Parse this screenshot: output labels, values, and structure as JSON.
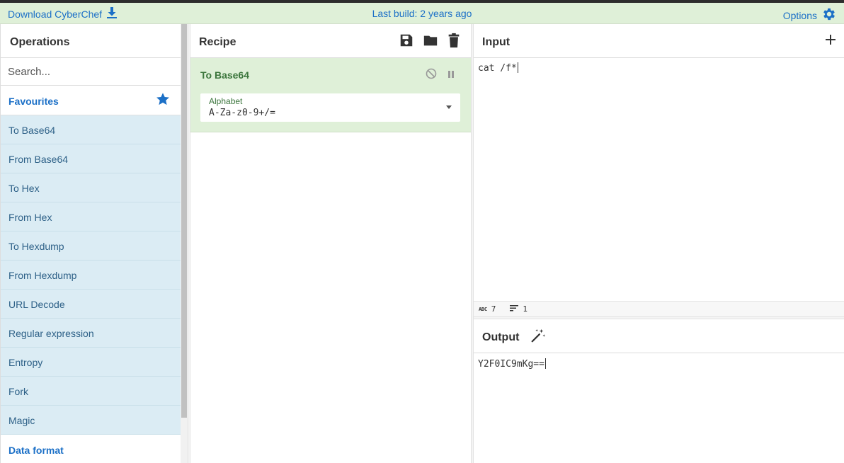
{
  "banner": {
    "download_label": "Download CyberChef",
    "last_build": "Last build: 2 years ago",
    "options_label": "Options"
  },
  "operations": {
    "title": "Operations",
    "search_placeholder": "Search...",
    "favourites_label": "Favourites",
    "items": [
      {
        "label": "To Base64"
      },
      {
        "label": "From Base64"
      },
      {
        "label": "To Hex"
      },
      {
        "label": "From Hex"
      },
      {
        "label": "To Hexdump"
      },
      {
        "label": "From Hexdump"
      },
      {
        "label": "URL Decode"
      },
      {
        "label": "Regular expression"
      },
      {
        "label": "Entropy"
      },
      {
        "label": "Fork"
      },
      {
        "label": "Magic"
      }
    ],
    "next_category": "Data format"
  },
  "recipe": {
    "title": "Recipe",
    "operation": {
      "name": "To Base64",
      "arg_label": "Alphabet",
      "arg_value": "A-Za-z0-9+/="
    }
  },
  "input": {
    "title": "Input",
    "text": "cat /f*",
    "length": "7",
    "lines": "1",
    "length_icon_text": "abc"
  },
  "output": {
    "title": "Output",
    "text": "Y2F0IC9mKg=="
  },
  "colors": {
    "accent": "#1c70c7",
    "banner_bg": "#dff0d8",
    "op_item_bg": "#dbecf4",
    "recipe_card_bg": "#dff0d8",
    "recipe_text": "#3c763d"
  }
}
